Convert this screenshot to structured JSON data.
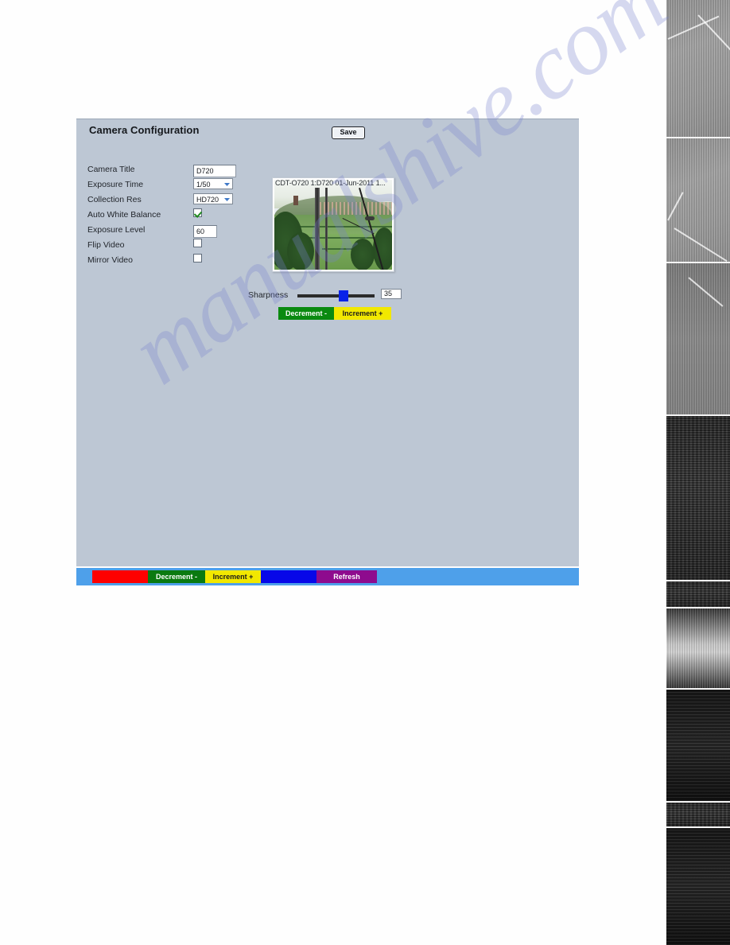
{
  "page": {
    "watermark": "manualshive.com"
  },
  "panel": {
    "title": "Camera Configuration",
    "save_label": "Save",
    "bg_color": "#bdc7d4"
  },
  "form": {
    "rows": [
      {
        "label": "Camera Title",
        "type": "text",
        "value": "D720"
      },
      {
        "label": "Exposure Time",
        "type": "select",
        "value": "1/50"
      },
      {
        "label": "Collection Res",
        "type": "select",
        "value": "HD720"
      },
      {
        "label": "Auto White Balance",
        "type": "checkbox",
        "value": "checked"
      },
      {
        "label": "Exposure Level",
        "type": "text",
        "value": "60"
      },
      {
        "label": "Flip Video",
        "type": "checkbox",
        "value": "unchecked"
      },
      {
        "label": "Mirror Video",
        "type": "checkbox",
        "value": "unchecked"
      }
    ]
  },
  "preview": {
    "osd_text": "CDT-O720 1:D720 01-Jun-2011 1...",
    "alt": "live camera view of green countryside valley with village on hillside"
  },
  "sharpness": {
    "label": "Sharpness",
    "value": "35",
    "position_percent": 55,
    "thumb_color": "#0a23e8"
  },
  "mid_buttons": {
    "decrement_label": "Decrement -",
    "increment_label": "Increment +",
    "decrement_color": "#0a8a10",
    "increment_color": "#f2e800"
  },
  "bottom_bar": {
    "bar_color": "#4ea0ea",
    "segments": [
      {
        "label": "",
        "color": "#fe0000",
        "name": "red"
      },
      {
        "label": "Decrement -",
        "color": "#0a7a10",
        "name": "green"
      },
      {
        "label": "Increment +",
        "color": "#f2e800",
        "name": "yellow"
      },
      {
        "label": "",
        "color": "#0707e8",
        "name": "blue"
      },
      {
        "label": "Refresh",
        "color": "#8e0b8e",
        "name": "purple"
      }
    ]
  }
}
